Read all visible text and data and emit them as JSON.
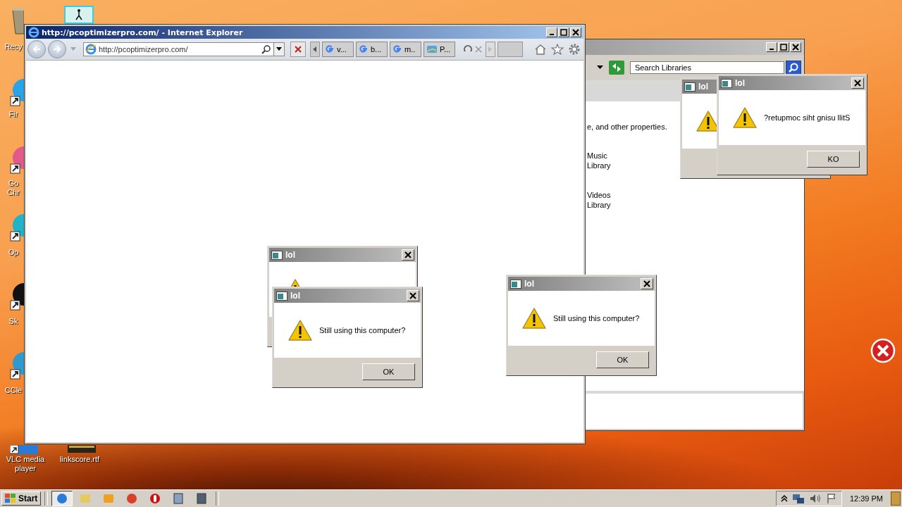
{
  "desktop_icons": [
    {
      "kind": "recycle",
      "label": "Recy"
    },
    {
      "kind": "firefox",
      "label": "Fir"
    },
    {
      "kind": "chrome",
      "label": "Go Chr"
    },
    {
      "kind": "opera",
      "label": "Op"
    },
    {
      "kind": "skype",
      "label": "Sk"
    },
    {
      "kind": "ccleaner",
      "label": "CCle"
    },
    {
      "kind": "vlc",
      "label": "VLC media player"
    },
    {
      "kind": "document",
      "label": "linkscore.rtf"
    }
  ],
  "explorer": {
    "search": {
      "placeholder": "Search Libraries"
    },
    "lines": [
      {
        "kind": "description",
        "text": "e, and other properties."
      },
      {
        "kind": "library",
        "name": "Music",
        "type": "Library"
      },
      {
        "kind": "library",
        "name": "Videos",
        "type": "Library"
      }
    ]
  },
  "browser": {
    "title": "http://pcoptimizerpro.com/ - Internet Explorer",
    "address": "http://pcoptimizerpro.com/",
    "tabs": [
      {
        "kind": "google",
        "label": "v...",
        "selected": false
      },
      {
        "kind": "google",
        "label": "b...",
        "selected": false
      },
      {
        "kind": "google",
        "label": "m..",
        "selected": false
      },
      {
        "kind": "page",
        "label": "P...",
        "selected": false
      }
    ]
  },
  "dialogs": [
    {
      "title": "lol"
    },
    {
      "title": "lol",
      "message": "Still using this computer?",
      "button": "OK"
    },
    {
      "title": "lol",
      "message": "Still using this computer?",
      "button": "OK"
    },
    {
      "title": "lol"
    },
    {
      "title": "lol",
      "message": "?retupmoc siht gnisu llitS",
      "button": "KO"
    }
  ],
  "taskbar": {
    "start": "Start",
    "apps": [
      {
        "kind": "ie",
        "selected": true
      },
      {
        "kind": "folder",
        "selected": false
      },
      {
        "kind": "media",
        "selected": false
      },
      {
        "kind": "chrome",
        "selected": false
      },
      {
        "kind": "opera",
        "selected": false
      },
      {
        "kind": "calculator",
        "selected": false
      },
      {
        "kind": "window",
        "selected": false
      }
    ],
    "clock": "12:39 PM"
  }
}
